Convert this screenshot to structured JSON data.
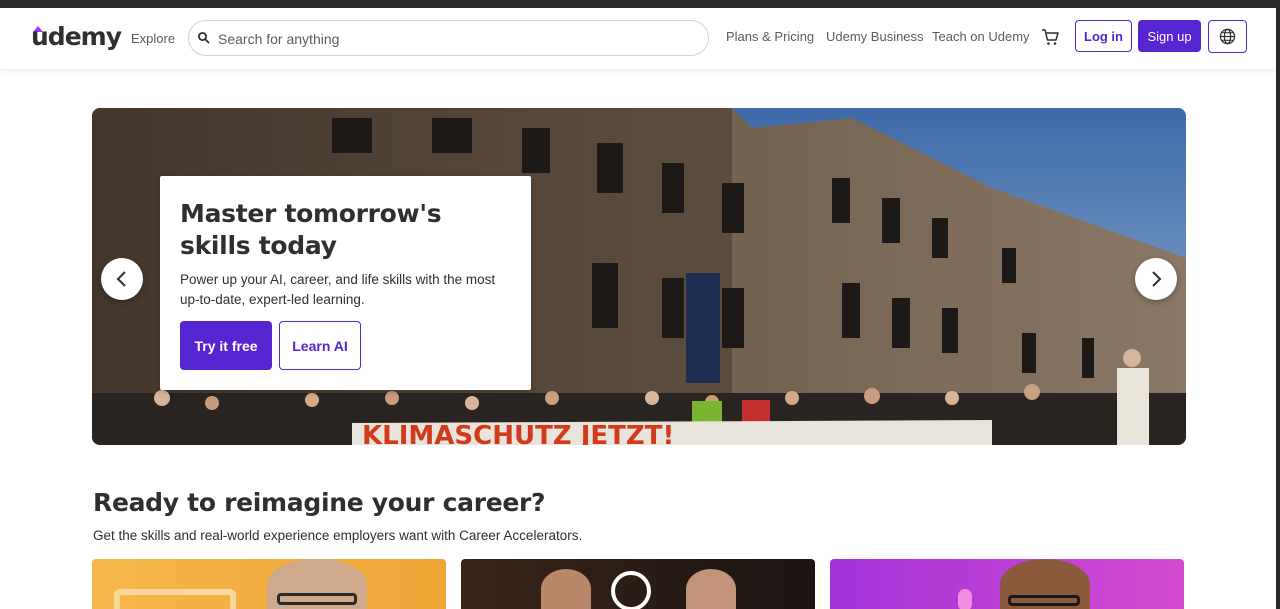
{
  "header": {
    "logo": "udemy",
    "explore": "Explore",
    "search": {
      "placeholder": "Search for anything"
    },
    "links": [
      "Plans & Pricing",
      "Udemy Business",
      "Teach on Udemy"
    ],
    "login_label": "Log in",
    "signup_label": "Sign up",
    "icons": {
      "search": "search-icon",
      "cart": "cart-icon",
      "language": "globe-icon"
    }
  },
  "hero": {
    "title": "Master tomorrow's skills today",
    "subtitle": "Power up your AI, career, and life skills with the most up-to-date, expert-led learning.",
    "primary_cta": "Try it free",
    "secondary_cta": "Learn AI",
    "prev_icon": "chevron-left-icon",
    "next_icon": "chevron-right-icon",
    "banner_text": "KLIMASCHUTZ JETZT!"
  },
  "career": {
    "title": "Ready to reimagine your career?",
    "subtitle": "Get the skills and real-world experience employers want with Career Accelerators."
  },
  "colors": {
    "brand": "#5624d0",
    "logo_accent": "#a435f0",
    "text": "#2d2f31"
  }
}
